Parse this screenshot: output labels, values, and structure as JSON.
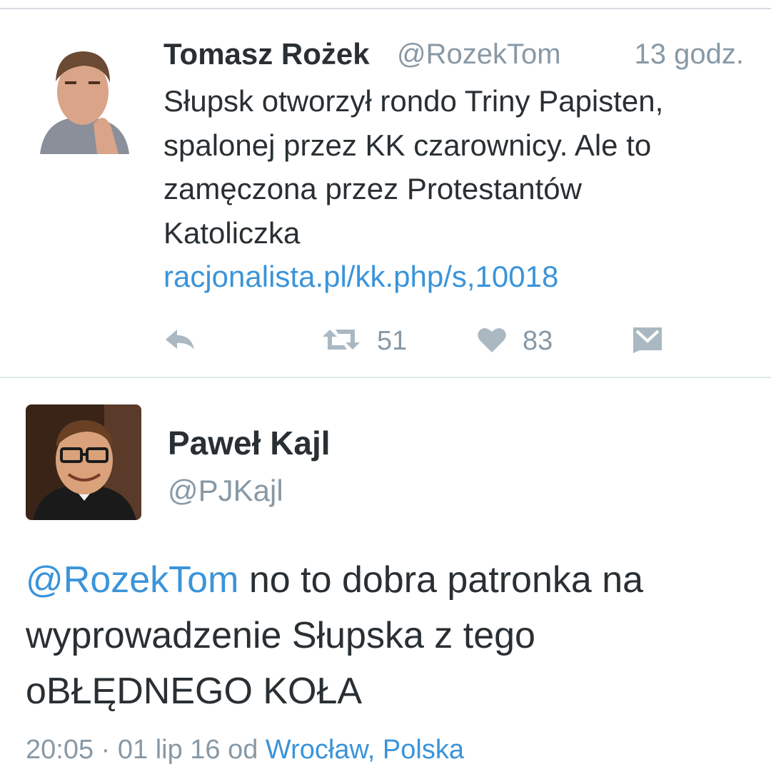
{
  "tweet1": {
    "author_name": "Tomasz Rożek",
    "author_handle": "@RozekTom",
    "time": "13 godz.",
    "text_lines": [
      "Słupsk otworzył rondo Triny Papisten,",
      "spalonej przez KK czarownicy. Ale to",
      "zamęczona przez Protestantów",
      "Katoliczka"
    ],
    "link": "racjonalista.pl/kk.php/s,10018",
    "actions": {
      "reply_icon": "reply-icon",
      "retweet_icon": "retweet-icon",
      "retweet_count": "51",
      "like_icon": "heart-icon",
      "like_count": "83",
      "dm_icon": "direct-message-icon"
    }
  },
  "tweet2": {
    "author_name": "Paweł Kajl",
    "author_handle": "@PJKajl",
    "mention": "@RozekTom",
    "text_first_rest": " no to dobra patronka na",
    "text_lines": [
      "wyprowadzenie Słupska z tego",
      "oBŁĘDNEGO KOŁA"
    ],
    "meta_time": "20:05 · 01 lip 16",
    "meta_from": " od ",
    "location": "Wrocław, Polska"
  },
  "colors": {
    "text": "#292f33",
    "muted": "#8899a6",
    "link": "#3b94d9",
    "divider": "#e1e8ed"
  }
}
